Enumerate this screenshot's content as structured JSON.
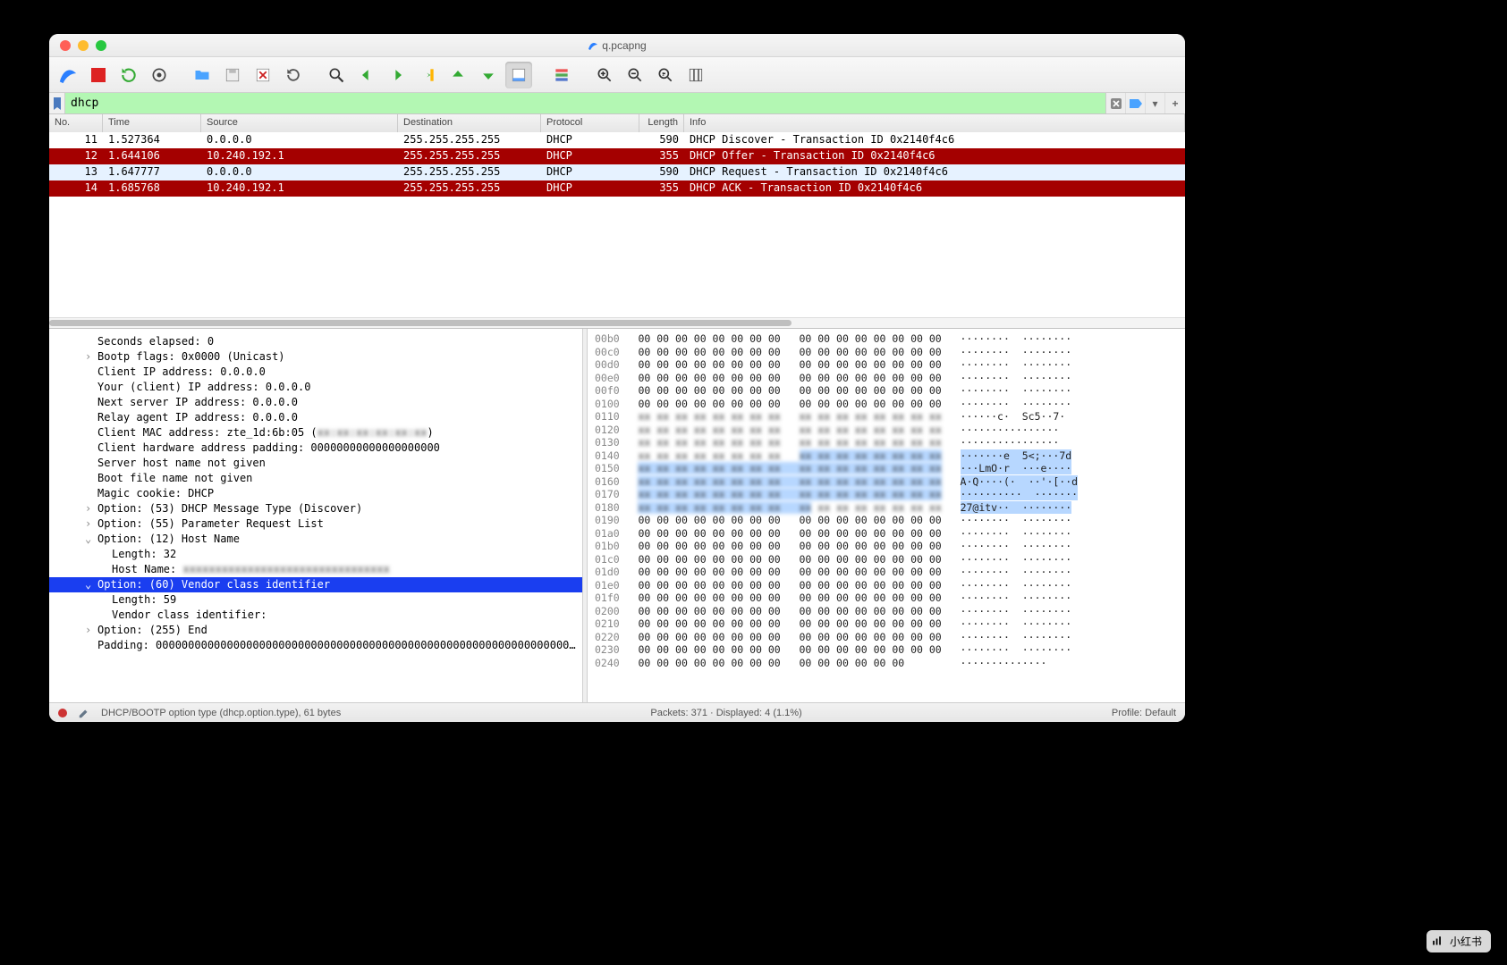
{
  "window": {
    "title": "q.pcapng"
  },
  "filter": {
    "value": "dhcp"
  },
  "columns": {
    "no": "No.",
    "time": "Time",
    "src": "Source",
    "dst": "Destination",
    "proto": "Protocol",
    "len": "Length",
    "info": "Info"
  },
  "packets": [
    {
      "style": "white",
      "no": "11",
      "time": "1.527364",
      "src": "0.0.0.0",
      "dst": "255.255.255.255",
      "proto": "DHCP",
      "len": "590",
      "info": "DHCP Discover  - Transaction ID 0x2140f4c6"
    },
    {
      "style": "red",
      "no": "12",
      "time": "1.644106",
      "src": "10.240.192.1",
      "dst": "255.255.255.255",
      "proto": "DHCP",
      "len": "355",
      "info": "DHCP Offer     - Transaction ID 0x2140f4c6"
    },
    {
      "style": "sel",
      "no": "13",
      "time": "1.647777",
      "src": "0.0.0.0",
      "dst": "255.255.255.255",
      "proto": "DHCP",
      "len": "590",
      "info": "DHCP Request   - Transaction ID 0x2140f4c6"
    },
    {
      "style": "red",
      "no": "14",
      "time": "1.685768",
      "src": "10.240.192.1",
      "dst": "255.255.255.255",
      "proto": "DHCP",
      "len": "355",
      "info": "DHCP ACK       - Transaction ID 0x2140f4c6"
    }
  ],
  "details": [
    {
      "ind": 1,
      "caret": "",
      "text": "Seconds elapsed: 0"
    },
    {
      "ind": 1,
      "caret": "›",
      "text": "Bootp flags: 0x0000 (Unicast)"
    },
    {
      "ind": 1,
      "caret": "",
      "text": "Client IP address: 0.0.0.0"
    },
    {
      "ind": 1,
      "caret": "",
      "text": "Your (client) IP address: 0.0.0.0"
    },
    {
      "ind": 1,
      "caret": "",
      "text": "Next server IP address: 0.0.0.0"
    },
    {
      "ind": 1,
      "caret": "",
      "text": "Relay agent IP address: 0.0.0.0"
    },
    {
      "ind": 1,
      "caret": "",
      "text": "Client MAC address: zte_1d:6b:05 (",
      "blurtail": "xx:xx:xx:xx:xx:xx",
      "tail": ")"
    },
    {
      "ind": 1,
      "caret": "",
      "text": "Client hardware address padding: 00000000000000000000"
    },
    {
      "ind": 1,
      "caret": "",
      "text": "Server host name not given"
    },
    {
      "ind": 1,
      "caret": "",
      "text": "Boot file name not given"
    },
    {
      "ind": 1,
      "caret": "",
      "text": "Magic cookie: DHCP"
    },
    {
      "ind": 1,
      "caret": "›",
      "text": "Option: (53) DHCP Message Type (Discover)"
    },
    {
      "ind": 1,
      "caret": "›",
      "text": "Option: (55) Parameter Request List"
    },
    {
      "ind": 1,
      "caret": "v",
      "text": "Option: (12) Host Name"
    },
    {
      "ind": 2,
      "caret": "",
      "text": "Length: 32"
    },
    {
      "ind": 2,
      "caret": "",
      "text": "Host Name: ",
      "blurtail": "xxxxxxxxxxxxxxxxxxxxxxxxxxxxxxxx"
    },
    {
      "ind": 1,
      "caret": "v",
      "text": "Option: (60) Vendor class identifier",
      "sel": true
    },
    {
      "ind": 2,
      "caret": "",
      "text": "Length: 59"
    },
    {
      "ind": 2,
      "caret": "",
      "text": "Vendor class identifier:"
    },
    {
      "ind": 1,
      "caret": "›",
      "text": "Option: (255) End"
    },
    {
      "ind": 1,
      "caret": "",
      "text": "Padding: 0000000000000000000000000000000000000000000000000000000000000000…"
    }
  ],
  "hex": {
    "zero_offsets": [
      "00b0",
      "00c0",
      "00d0",
      "00e0",
      "00f0",
      "0100"
    ],
    "blur_rows_a": [
      "0110",
      "0120",
      "0130"
    ],
    "highlight_rows": [
      "0140",
      "0150",
      "0160",
      "0170",
      "0180"
    ],
    "ascii_right": [
      "······c·  Sc5··7·",
      "················",
      "················",
      "·······e  5<;···7d",
      "···LmO·r  ···e····",
      "A·Q····(·  ··'·[··d",
      "··········  ·······",
      "27@itv··  ········"
    ],
    "zero_offsets2": [
      "0190",
      "01a0",
      "01b0",
      "01c0",
      "01d0",
      "01e0",
      "01f0",
      "0200",
      "0210",
      "0220",
      "0230"
    ],
    "last": {
      "off": "0240",
      "bytes": "00 00 00 00 00 00 00 00   00 00 00 00 00 00",
      "ascii": "··············"
    }
  },
  "status": {
    "left": "DHCP/BOOTP option type (dhcp.option.type), 61 bytes",
    "mid": "Packets: 371 · Displayed: 4 (1.1%)",
    "right": "Profile: Default"
  },
  "toolbar_icons": [
    "fin",
    "stop",
    "restart",
    "settings",
    "sep",
    "open",
    "save",
    "close",
    "reload",
    "sep",
    "find",
    "back",
    "forward",
    "jump",
    "up",
    "down",
    "recent",
    "sep",
    "layout",
    "sep",
    "zoomin",
    "zoomout",
    "zoom100",
    "resize"
  ]
}
